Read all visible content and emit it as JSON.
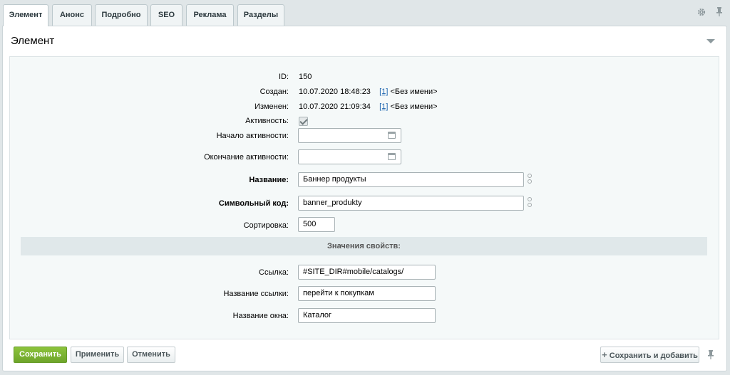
{
  "tabs": [
    "Элемент",
    "Анонс",
    "Подробно",
    "SEO",
    "Реклама",
    "Разделы"
  ],
  "icons": {
    "settings": "gear-icon",
    "pin": "pin-icon",
    "collapse": "triangle-down-icon",
    "calendar": "calendar-icon",
    "link": "chain-link-icon",
    "add": "plus-icon"
  },
  "section": {
    "title": "Элемент"
  },
  "fields": {
    "id": {
      "label": "ID:",
      "value": "150"
    },
    "created": {
      "label": "Создан:",
      "value": "10.07.2020 18:48:23",
      "user_id": "[1]",
      "user_name": "<Без имени>"
    },
    "modified": {
      "label": "Изменен:",
      "value": "10.07.2020 21:09:34",
      "user_id": "[1]",
      "user_name": "<Без имени>"
    },
    "active": {
      "label": "Активность:",
      "checked": true
    },
    "active_from": {
      "label": "Начало активности:",
      "value": ""
    },
    "active_to": {
      "label": "Окончание активности:",
      "value": ""
    },
    "name": {
      "label": "Название:",
      "value": "Баннер продукты"
    },
    "code": {
      "label": "Символьный код:",
      "value": "banner_produkty"
    },
    "sort": {
      "label": "Сортировка:",
      "value": "500"
    }
  },
  "properties": {
    "header": "Значения свойств:",
    "link": {
      "label": "Ссылка:",
      "value": "#SITE_DIR#mobile/catalogs/"
    },
    "link_name": {
      "label": "Название ссылки:",
      "value": "перейти к покупкам"
    },
    "window_name": {
      "label": "Название окна:",
      "value": "Каталог"
    }
  },
  "buttons": {
    "save": "Сохранить",
    "apply": "Применить",
    "cancel": "Отменить",
    "save_add": "Сохранить и добавить"
  },
  "colors": {
    "primary": "#7bb434",
    "link": "#2067b0",
    "subheader_bg": "#e0e8ea",
    "form_bg": "#f5f9f9"
  }
}
